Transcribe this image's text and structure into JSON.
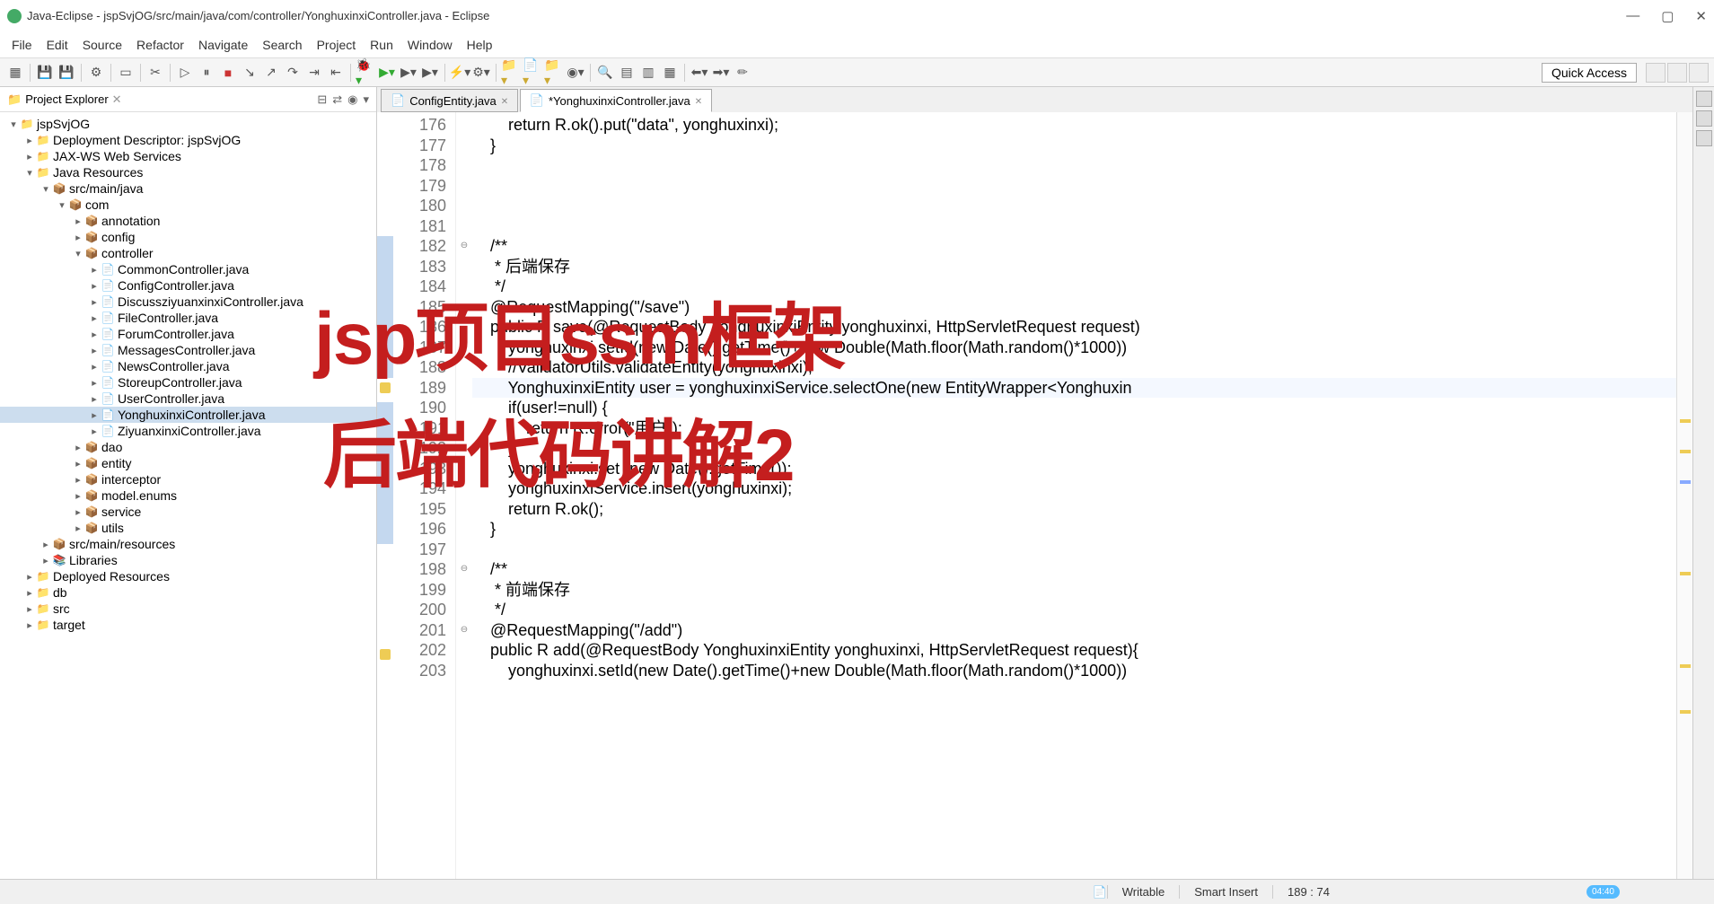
{
  "window": {
    "title": "Java-Eclipse - jspSvjOG/src/main/java/com/controller/YonghuxinxiController.java - Eclipse"
  },
  "menu": [
    "File",
    "Edit",
    "Source",
    "Refactor",
    "Navigate",
    "Search",
    "Project",
    "Run",
    "Window",
    "Help"
  ],
  "quick_access": "Quick Access",
  "explorer": {
    "title": "Project Explorer",
    "tree": [
      {
        "d": 0,
        "tw": "▾",
        "ic": "proj",
        "l": "jspSvjOG"
      },
      {
        "d": 1,
        "tw": "▸",
        "ic": "folder",
        "l": "Deployment Descriptor: jspSvjOG"
      },
      {
        "d": 1,
        "tw": "▸",
        "ic": "folder",
        "l": "JAX-WS Web Services"
      },
      {
        "d": 1,
        "tw": "▾",
        "ic": "folder",
        "l": "Java Resources"
      },
      {
        "d": 2,
        "tw": "▾",
        "ic": "pkg",
        "l": "src/main/java"
      },
      {
        "d": 3,
        "tw": "▾",
        "ic": "pkg",
        "l": "com"
      },
      {
        "d": 4,
        "tw": "▸",
        "ic": "pkg",
        "l": "annotation"
      },
      {
        "d": 4,
        "tw": "▸",
        "ic": "pkg",
        "l": "config"
      },
      {
        "d": 4,
        "tw": "▾",
        "ic": "pkg",
        "l": "controller"
      },
      {
        "d": 5,
        "tw": "▸",
        "ic": "java",
        "l": "CommonController.java"
      },
      {
        "d": 5,
        "tw": "▸",
        "ic": "java",
        "l": "ConfigController.java"
      },
      {
        "d": 5,
        "tw": "▸",
        "ic": "java",
        "l": "DiscussziyuanxinxiController.java"
      },
      {
        "d": 5,
        "tw": "▸",
        "ic": "java",
        "l": "FileController.java"
      },
      {
        "d": 5,
        "tw": "▸",
        "ic": "java",
        "l": "ForumController.java"
      },
      {
        "d": 5,
        "tw": "▸",
        "ic": "java",
        "l": "MessagesController.java"
      },
      {
        "d": 5,
        "tw": "▸",
        "ic": "java",
        "l": "NewsController.java"
      },
      {
        "d": 5,
        "tw": "▸",
        "ic": "java",
        "l": "StoreupController.java"
      },
      {
        "d": 5,
        "tw": "▸",
        "ic": "java",
        "l": "UserController.java"
      },
      {
        "d": 5,
        "tw": "▸",
        "ic": "java",
        "l": "YonghuxinxiController.java",
        "sel": true
      },
      {
        "d": 5,
        "tw": "▸",
        "ic": "java",
        "l": "ZiyuanxinxiController.java"
      },
      {
        "d": 4,
        "tw": "▸",
        "ic": "pkg",
        "l": "dao"
      },
      {
        "d": 4,
        "tw": "▸",
        "ic": "pkg",
        "l": "entity"
      },
      {
        "d": 4,
        "tw": "▸",
        "ic": "pkg",
        "l": "interceptor"
      },
      {
        "d": 4,
        "tw": "▸",
        "ic": "pkg",
        "l": "model.enums"
      },
      {
        "d": 4,
        "tw": "▸",
        "ic": "pkg",
        "l": "service"
      },
      {
        "d": 4,
        "tw": "▸",
        "ic": "pkg",
        "l": "utils"
      },
      {
        "d": 2,
        "tw": "▸",
        "ic": "pkg",
        "l": "src/main/resources"
      },
      {
        "d": 2,
        "tw": "▸",
        "ic": "jar",
        "l": "Libraries"
      },
      {
        "d": 1,
        "tw": "▸",
        "ic": "folder",
        "l": "Deployed Resources"
      },
      {
        "d": 1,
        "tw": "▸",
        "ic": "folder",
        "l": "db"
      },
      {
        "d": 1,
        "tw": "▸",
        "ic": "folder",
        "l": "src"
      },
      {
        "d": 1,
        "tw": "▸",
        "ic": "folder",
        "l": "target"
      }
    ]
  },
  "tabs": [
    {
      "label": "ConfigEntity.java",
      "dirty": false,
      "active": false
    },
    {
      "label": "*YonghuxinxiController.java",
      "dirty": true,
      "active": true
    }
  ],
  "code": {
    "start": 176,
    "lines": [
      {
        "n": 176,
        "txt": "        <kw>return</kw> R.<il>ok</il>().put(<str>\"data\"</str>, yonghuxinxi);"
      },
      {
        "n": 177,
        "txt": "    }"
      },
      {
        "n": 178,
        "txt": ""
      },
      {
        "n": 179,
        "txt": ""
      },
      {
        "n": 180,
        "txt": ""
      },
      {
        "n": 181,
        "txt": ""
      },
      {
        "n": 182,
        "txt": "    <doc>/**</doc>",
        "fold": "⊖",
        "ann": "bp"
      },
      {
        "n": 183,
        "txt": "<doc>     * 后端保存</doc>",
        "ann": "bp"
      },
      {
        "n": 184,
        "txt": "<doc>     */</doc>",
        "ann": "bp"
      },
      {
        "n": 185,
        "txt": "    @RequestMapping(<str>\"/save\"</str>)",
        "ann": "bp"
      },
      {
        "n": 186,
        "txt": "    <kw>public</kw> R save(@RequestBody YonghuxinxiEntity yonghuxinxi, HttpServletRequest request)",
        "ann": "bp"
      },
      {
        "n": 187,
        "txt": "        yonghuxinxi.setId(<kw>new</kw> Date().getTime()+<kw>new</kw> Double(Math.<il>floor</il>(Math.<il>random</il>()*1000))",
        "ann": "bp"
      },
      {
        "n": 188,
        "txt": "        <com>//ValidatorUtils.validateEntity(yonghuxinxi);</com>",
        "ann": "bp"
      },
      {
        "n": 189,
        "txt": "        YonghuxinxiEntity user = <hl>yonghuxinxiService.selectOne(</hl><hl><kw>new</kw></hl><hl> EntityW</hl>rapper&lt;Yonghuxin",
        "ann": "warn",
        "cur": true
      },
      {
        "n": 190,
        "txt": "        <kw>if</kw>(user!=<kw>null</kw>) {",
        "ann": "bp"
      },
      {
        "n": 191,
        "txt": "            <kw>return</kw> R.<il>error</il>(<str>\"用户\"</str>);",
        "ann": "bp"
      },
      {
        "n": 192,
        "txt": "        }",
        "ann": "bp"
      },
      {
        "n": 193,
        "txt": "        yonghuxinxi.set (<kw>new</kw> Date().getTime());",
        "ann": "bp"
      },
      {
        "n": 194,
        "txt": "        yonghuxinxiService.insert(yonghuxinxi);",
        "ann": "bp"
      },
      {
        "n": 195,
        "txt": "        <kw>return</kw> R.<il>ok</il>();",
        "ann": "bp"
      },
      {
        "n": 196,
        "txt": "    }",
        "ann": "bp"
      },
      {
        "n": 197,
        "txt": ""
      },
      {
        "n": 198,
        "txt": "    <doc>/**</doc>",
        "fold": "⊖"
      },
      {
        "n": 199,
        "txt": "<doc>     * 前端保存</doc>"
      },
      {
        "n": 200,
        "txt": "<doc>     */</doc>"
      },
      {
        "n": 201,
        "txt": "    @RequestMapping(<str>\"/add\"</str>)",
        "fold": "⊖"
      },
      {
        "n": 202,
        "txt": "    <kw>public</kw> R add(@RequestBody YonghuxinxiEntity yonghuxinxi, HttpServletRequest request){",
        "ann": "warn"
      },
      {
        "n": 203,
        "txt": "        yonghuxinxi.setId(<kw>new</kw> Date().getTime()+<kw>new</kw> Double(Math.<il>floor</il>(Math.<il>random</il>()*1000))"
      }
    ]
  },
  "status": {
    "writable": "Writable",
    "insert": "Smart Insert",
    "pos": "189 : 74"
  },
  "overlay": {
    "line1": "jsp项目ssm框架",
    "line2": "后端代码讲解2"
  },
  "time": "04:40"
}
